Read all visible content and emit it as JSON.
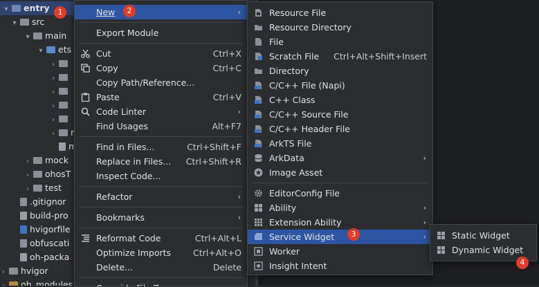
{
  "project_tree": {
    "items": [
      {
        "label": "entry",
        "chevron": "▾",
        "icon": "module-folder"
      },
      {
        "label": "src",
        "chevron": "▾",
        "icon": "folder"
      },
      {
        "label": "main",
        "chevron": "▾",
        "icon": "folder"
      },
      {
        "label": "ets",
        "chevron": "▾",
        "icon": "folder"
      },
      {
        "label": "",
        "chevron": "›",
        "icon": "folder"
      },
      {
        "label": "",
        "chevron": "›",
        "icon": "folder"
      },
      {
        "label": "",
        "chevron": "›",
        "icon": "folder"
      },
      {
        "label": "",
        "chevron": "›",
        "icon": "folder"
      },
      {
        "label": "",
        "chevron": "›",
        "icon": "folder"
      },
      {
        "label": "res",
        "chevron": "›",
        "icon": "folder"
      },
      {
        "label": "mo",
        "chevron": "",
        "icon": "json-file"
      },
      {
        "label": "mock",
        "chevron": "›",
        "icon": "folder"
      },
      {
        "label": "ohosT",
        "chevron": "›",
        "icon": "folder"
      },
      {
        "label": "test",
        "chevron": "›",
        "icon": "folder"
      },
      {
        "label": ".gitignor",
        "chevron": "",
        "icon": "file"
      },
      {
        "label": "build-pro",
        "chevron": "",
        "icon": "file"
      },
      {
        "label": "hvigorfile",
        "chevron": "",
        "icon": "ts-file"
      },
      {
        "label": "obfuscati",
        "chevron": "",
        "icon": "file"
      },
      {
        "label": "oh-packa",
        "chevron": "",
        "icon": "json-file"
      },
      {
        "label": "hvigor",
        "chevron": "›",
        "icon": "folder"
      },
      {
        "label": "oh_modules",
        "chevron": "›",
        "icon": "folder"
      }
    ]
  },
  "context_menu": {
    "items": [
      {
        "label": "New",
        "shortcut": "",
        "submenu": true
      },
      {
        "label": "Export Module",
        "shortcut": ""
      },
      {
        "label": "Cut",
        "shortcut": "Ctrl+X",
        "icon": "scissors-icon"
      },
      {
        "label": "Copy",
        "shortcut": "Ctrl+C",
        "icon": "copy-icon"
      },
      {
        "label": "Copy Path/Reference...",
        "shortcut": ""
      },
      {
        "label": "Paste",
        "shortcut": "Ctrl+V",
        "icon": "paste-icon"
      },
      {
        "label": "Code Linter",
        "shortcut": "",
        "submenu": true,
        "icon": "linter-icon"
      },
      {
        "label": "Find Usages",
        "shortcut": "Alt+F7"
      },
      {
        "label": "Find in Files...",
        "shortcut": "Ctrl+Shift+F"
      },
      {
        "label": "Replace in Files...",
        "shortcut": "Ctrl+Shift+R"
      },
      {
        "label": "Inspect Code...",
        "shortcut": ""
      },
      {
        "label": "Refactor",
        "shortcut": "",
        "submenu": true
      },
      {
        "label": "Bookmarks",
        "shortcut": "",
        "submenu": true
      },
      {
        "label": "Reformat Code",
        "shortcut": "Ctrl+Alt+L",
        "icon": "reformat-icon"
      },
      {
        "label": "Optimize Imports",
        "shortcut": "Ctrl+Alt+O"
      },
      {
        "label": "Delete...",
        "shortcut": "Delete"
      },
      {
        "label": "Override File Type",
        "shortcut": ""
      }
    ]
  },
  "new_submenu": {
    "items": [
      {
        "label": "Resource File",
        "shortcut": ""
      },
      {
        "label": "Resource Directory",
        "shortcut": ""
      },
      {
        "label": "File",
        "shortcut": ""
      },
      {
        "label": "Scratch File",
        "shortcut": "Ctrl+Alt+Shift+Insert"
      },
      {
        "label": "Directory",
        "shortcut": ""
      },
      {
        "label": "C/C++ File (Napi)",
        "shortcut": ""
      },
      {
        "label": "C++ Class",
        "shortcut": ""
      },
      {
        "label": "C/C++ Source File",
        "shortcut": ""
      },
      {
        "label": "C/C++ Header File",
        "shortcut": ""
      },
      {
        "label": "ArkTS File",
        "shortcut": ""
      },
      {
        "label": "ArkData",
        "shortcut": "",
        "submenu": true
      },
      {
        "label": "Image Asset",
        "shortcut": ""
      },
      {
        "label": "EditorConfig File",
        "shortcut": ""
      },
      {
        "label": "Ability",
        "shortcut": "",
        "submenu": true
      },
      {
        "label": "Extension Ability",
        "shortcut": "",
        "submenu": true
      },
      {
        "label": "Service Widget",
        "shortcut": "",
        "submenu": true
      },
      {
        "label": "Worker",
        "shortcut": ""
      },
      {
        "label": "Insight Intent",
        "shortcut": ""
      }
    ]
  },
  "widget_submenu": {
    "items": [
      {
        "label": "Static Widget"
      },
      {
        "label": "Dynamic Widget"
      }
    ]
  },
  "badges": [
    "1",
    "2",
    "3",
    "4"
  ],
  "glyphs": {
    "submenu_arrow": "›"
  },
  "colors": {
    "highlight": "#2e55a2",
    "tree_selection": "#2e436e",
    "badge": "#e23c2a",
    "background": "#2b2d30"
  }
}
